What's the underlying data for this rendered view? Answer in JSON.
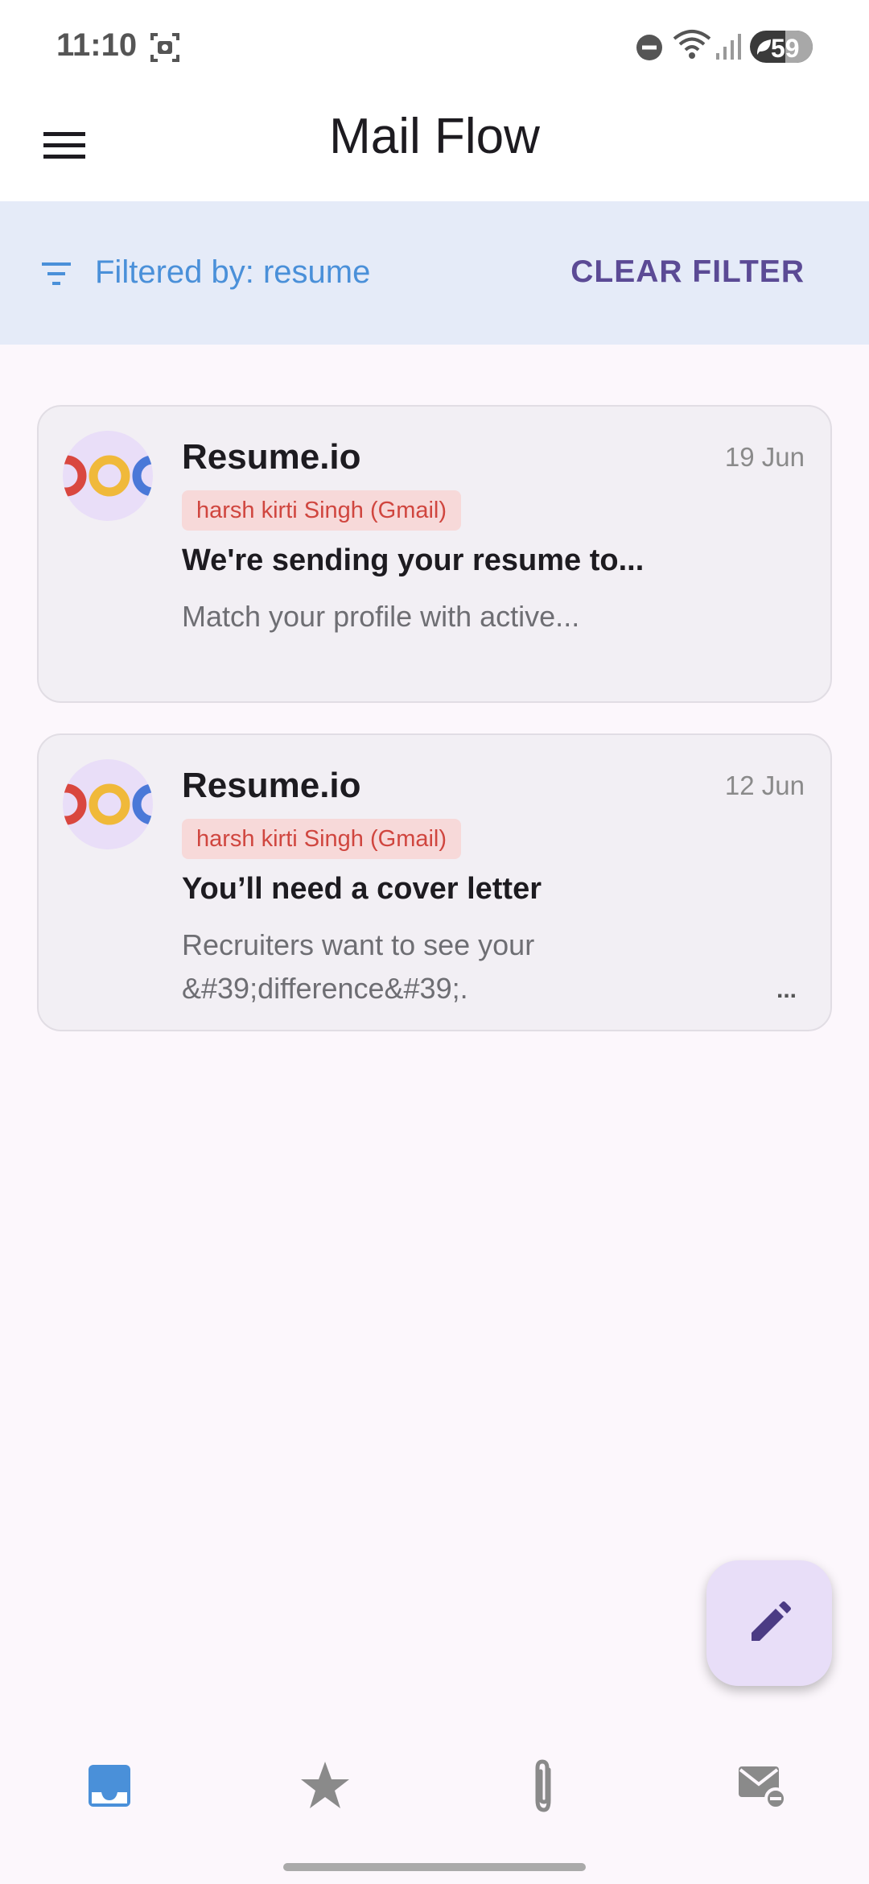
{
  "status_bar": {
    "time": "11:10",
    "battery_level": "59"
  },
  "app_bar": {
    "title": "Mail Flow"
  },
  "filter_bar": {
    "label": "Filtered by: resume",
    "clear_label": "CLEAR FILTER"
  },
  "emails": [
    {
      "sender": "Resume.io",
      "date": "19 Jun",
      "account": "harsh kirti Singh (Gmail)",
      "subject": "We're sending your resume to...",
      "preview": "Match your profile with active...",
      "more": ""
    },
    {
      "sender": "Resume.io",
      "date": "12 Jun",
      "account": "harsh kirti Singh (Gmail)",
      "subject": "You’ll need a cover letter",
      "preview": "Recruiters want to see your &#39;difference&#39;.",
      "more": "..."
    }
  ],
  "colors": {
    "accent": "#4a90d9",
    "clear_filter": "#5b4a95",
    "account_badge_bg": "#f7d9d9",
    "account_badge_text": "#d0463f",
    "fab_bg": "#e8def8"
  },
  "bottom_nav": {
    "items": [
      "inbox-icon",
      "star-icon",
      "paperclip-icon",
      "unsubscribe-icon"
    ],
    "active": "inbox-icon"
  }
}
